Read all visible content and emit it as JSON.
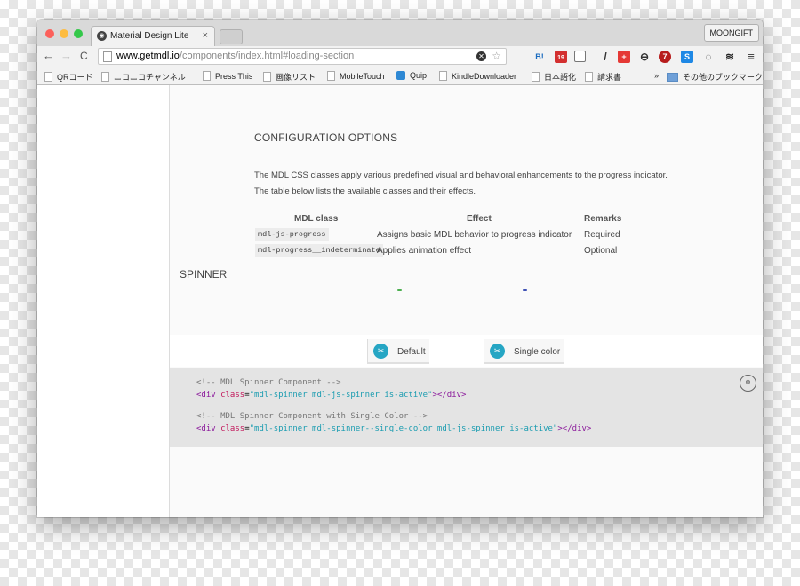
{
  "browser": {
    "tab_title": "Material Design Lite",
    "tab_close": "×",
    "profile": "MOONGIFT",
    "url_host": "www.getmdl.io",
    "url_path": "/components/index.html#loading-section",
    "extension_icons": [
      "stop-icon",
      "hatena-bookmark-icon",
      "pocket-badge-icon",
      "layers-icon",
      "eyedropper-icon",
      "red-cross-icon",
      "refresh-icon",
      "ublock-icon",
      "s-icon",
      "sync-icon",
      "buffer-icon",
      "menu-icon"
    ],
    "extension_labels": {
      "hatena": "B!",
      "badge": "19",
      "ublock": "7"
    }
  },
  "bookmarks": {
    "items": [
      "QRコード",
      "ニコニコチャンネル",
      "Press This",
      "画像リスト",
      "MobileTouch",
      "Quip",
      "KindleDownloader",
      "日本語化",
      "請求書"
    ],
    "overflow": "»",
    "other": "その他のブックマーク"
  },
  "page": {
    "config_heading": "CONFIGURATION OPTIONS",
    "para1": "The MDL CSS classes apply various predefined visual and behavioral enhancements to the progress indicator.",
    "para2": "The table below lists the available classes and their effects.",
    "table": {
      "headers": [
        "MDL class",
        "Effect",
        "Remarks"
      ],
      "rows": [
        {
          "class": "mdl-js-progress",
          "effect": "Assigns basic MDL behavior to progress indicator",
          "remarks": "Required"
        },
        {
          "class": "mdl-progress__indeterminate",
          "effect": "Applies animation effect",
          "remarks": "Optional"
        }
      ]
    },
    "spinner_heading": "SPINNER",
    "demo_tabs": [
      "Default",
      "Single color"
    ],
    "code": {
      "comment1": "<!-- MDL Spinner Component -->",
      "comment2": "<!-- MDL Spinner Component with Single Color -->",
      "line1": {
        "open": "<div ",
        "attr": "class",
        "eq": "=",
        "value": "\"mdl-spinner mdl-js-spinner is-active\"",
        "close": "></div>"
      },
      "line2": {
        "open": "<div ",
        "attr": "class",
        "eq": "=",
        "value": "\"mdl-spinner mdl-spinner--single-color mdl-js-spinner is-active\"",
        "close": "></div>"
      }
    }
  },
  "colors": {
    "spinner_default": "#4caf50",
    "spinner_single": "#3f51b5",
    "accent": "#26a6c4"
  }
}
